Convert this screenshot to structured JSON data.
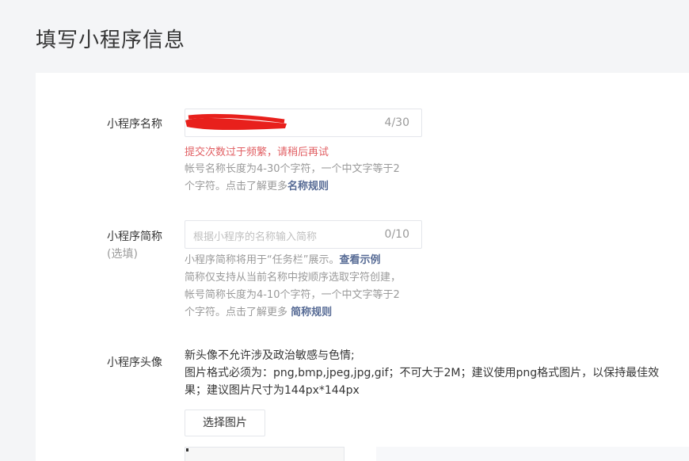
{
  "page": {
    "title": "填写小程序信息"
  },
  "name_field": {
    "label": "小程序名称",
    "counter": "4/30",
    "error": "提交次数过于频繁，请稍后再试",
    "hint_line1": "帐号名称长度为4-30个字符，一个中文字等于2",
    "hint_line2_prefix": "个字符。点击了解更多",
    "hint_link": "名称规则"
  },
  "short_name_field": {
    "label": "小程序简称",
    "sublabel": "(选填)",
    "placeholder": "根据小程序的名称输入简称",
    "counter": "0/10",
    "hint_line1_prefix": "小程序简称将用于“任务栏”展示。",
    "hint_line1_link": "查看示例",
    "hint_line2": "简称仅支持从当前名称中按顺序选取字符创建，",
    "hint_line3": "帐号简称长度为4-10个字符，一个中文字等于2",
    "hint_line4_prefix": "个字符。点击了解更多 ",
    "hint_line4_link": "简称规则"
  },
  "avatar_field": {
    "label": "小程序头像",
    "desc_line1": "新头像不允许涉及政治敏感与色情;",
    "desc_line2": "图片格式必须为：png,bmp,jpeg,jpg,gif；不可大于2M；建议使用png格式图片，以保持最佳效",
    "desc_line3": "果；建议图片尺寸为144px*144px",
    "select_button": "选择图片"
  },
  "colors": {
    "error": "#e15f63",
    "link": "#576b95",
    "redaction": "#e8201c"
  }
}
